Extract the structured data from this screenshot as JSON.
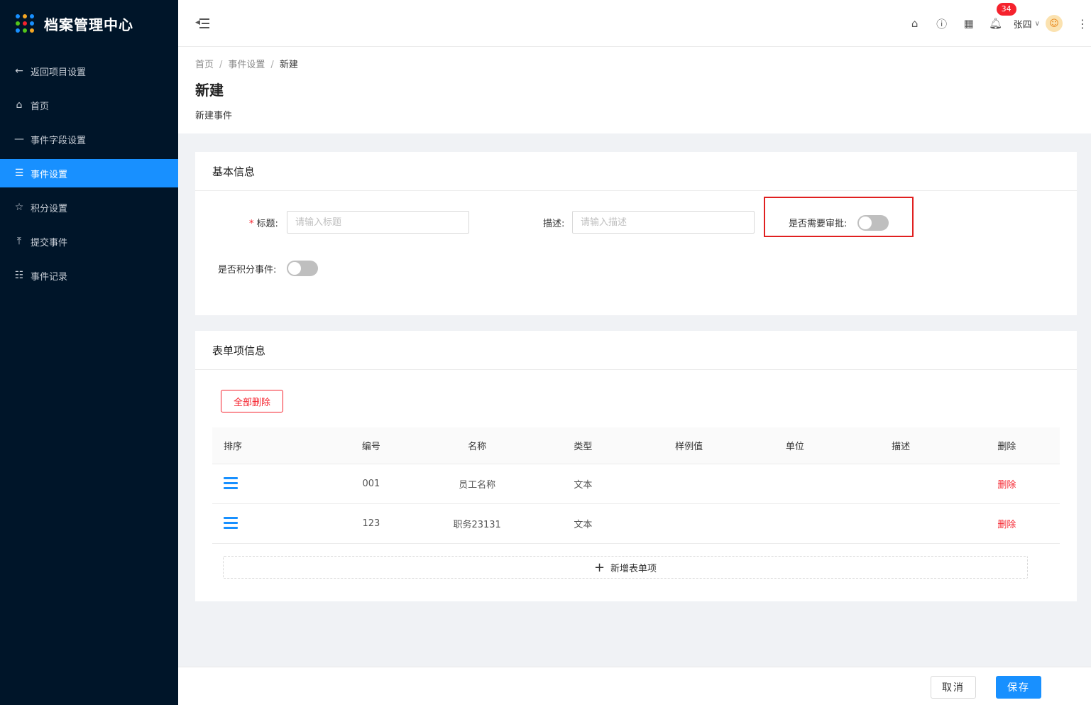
{
  "app": {
    "title": "档案管理中心",
    "logo_dot_colors": [
      "#1890ff",
      "#f5a623",
      "#1890ff",
      "#52c41a",
      "#f5222d",
      "#1890ff",
      "#1890ff",
      "#52c41a",
      "#f5a623"
    ]
  },
  "sidebar": {
    "items": [
      {
        "label": "返回项目设置",
        "icon": "arrow-left-icon",
        "glyph": "←",
        "active": false
      },
      {
        "label": "首页",
        "icon": "home-icon",
        "glyph": "⌂",
        "active": false
      },
      {
        "label": "事件字段设置",
        "icon": "minus-icon",
        "glyph": "—",
        "active": false
      },
      {
        "label": "事件设置",
        "icon": "menu-icon",
        "glyph": "☰",
        "active": true
      },
      {
        "label": "积分设置",
        "icon": "star-icon",
        "glyph": "☆",
        "active": false
      },
      {
        "label": "提交事件",
        "icon": "upload-icon",
        "glyph": "⤒",
        "active": false
      },
      {
        "label": "事件记录",
        "icon": "list-icon",
        "glyph": "☷",
        "active": false
      }
    ]
  },
  "header": {
    "notification_count": "34",
    "user_name": "张四"
  },
  "breadcrumb": {
    "items": [
      "首页",
      "事件设置"
    ],
    "current": "新建"
  },
  "page": {
    "title": "新建",
    "subtitle": "新建事件"
  },
  "basic_info": {
    "section_title": "基本信息",
    "title_label": "标题:",
    "title_placeholder": "请输入标题",
    "title_value": "",
    "desc_label": "描述:",
    "desc_placeholder": "请输入描述",
    "desc_value": "",
    "approval_label": "是否需要审批:",
    "approval_on": false,
    "points_label": "是否积分事件:",
    "points_on": false
  },
  "form_items": {
    "section_title": "表单项信息",
    "delete_all_label": "全部删除",
    "columns": [
      "排序",
      "编号",
      "名称",
      "类型",
      "样例值",
      "单位",
      "描述",
      "删除"
    ],
    "rows": [
      {
        "code": "001",
        "name": "员工名称",
        "type": "文本",
        "sample": "",
        "unit": "",
        "desc": "",
        "delete_label": "删除"
      },
      {
        "code": "123",
        "name": "职务23131",
        "type": "文本",
        "sample": "",
        "unit": "",
        "desc": "",
        "delete_label": "删除"
      }
    ],
    "add_label": "新增表单项"
  },
  "footer": {
    "cancel_label": "取消",
    "save_label": "保存"
  }
}
